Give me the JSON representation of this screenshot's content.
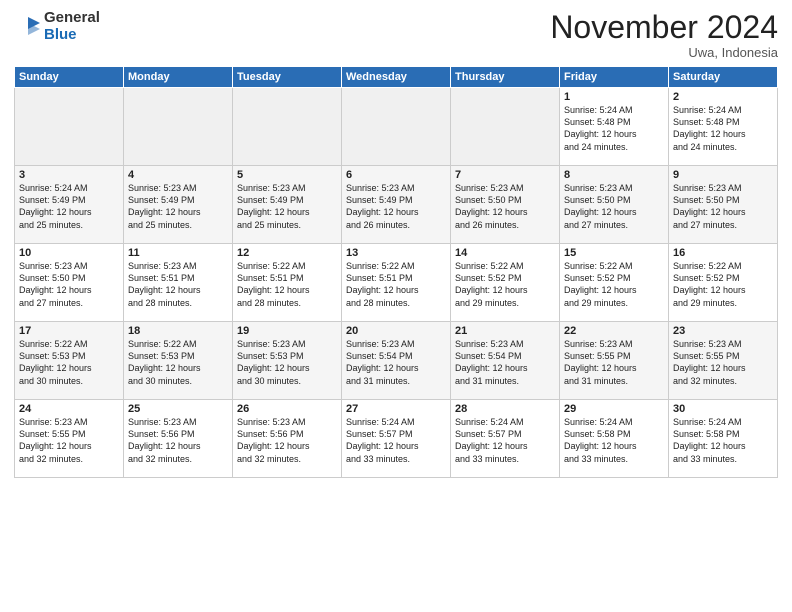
{
  "logo": {
    "general": "General",
    "blue": "Blue"
  },
  "title": "November 2024",
  "location": "Uwa, Indonesia",
  "headers": [
    "Sunday",
    "Monday",
    "Tuesday",
    "Wednesday",
    "Thursday",
    "Friday",
    "Saturday"
  ],
  "weeks": [
    [
      {
        "day": "",
        "info": ""
      },
      {
        "day": "",
        "info": ""
      },
      {
        "day": "",
        "info": ""
      },
      {
        "day": "",
        "info": ""
      },
      {
        "day": "",
        "info": ""
      },
      {
        "day": "1",
        "info": "Sunrise: 5:24 AM\nSunset: 5:48 PM\nDaylight: 12 hours\nand 24 minutes."
      },
      {
        "day": "2",
        "info": "Sunrise: 5:24 AM\nSunset: 5:48 PM\nDaylight: 12 hours\nand 24 minutes."
      }
    ],
    [
      {
        "day": "3",
        "info": "Sunrise: 5:24 AM\nSunset: 5:49 PM\nDaylight: 12 hours\nand 25 minutes."
      },
      {
        "day": "4",
        "info": "Sunrise: 5:23 AM\nSunset: 5:49 PM\nDaylight: 12 hours\nand 25 minutes."
      },
      {
        "day": "5",
        "info": "Sunrise: 5:23 AM\nSunset: 5:49 PM\nDaylight: 12 hours\nand 25 minutes."
      },
      {
        "day": "6",
        "info": "Sunrise: 5:23 AM\nSunset: 5:49 PM\nDaylight: 12 hours\nand 26 minutes."
      },
      {
        "day": "7",
        "info": "Sunrise: 5:23 AM\nSunset: 5:50 PM\nDaylight: 12 hours\nand 26 minutes."
      },
      {
        "day": "8",
        "info": "Sunrise: 5:23 AM\nSunset: 5:50 PM\nDaylight: 12 hours\nand 27 minutes."
      },
      {
        "day": "9",
        "info": "Sunrise: 5:23 AM\nSunset: 5:50 PM\nDaylight: 12 hours\nand 27 minutes."
      }
    ],
    [
      {
        "day": "10",
        "info": "Sunrise: 5:23 AM\nSunset: 5:50 PM\nDaylight: 12 hours\nand 27 minutes."
      },
      {
        "day": "11",
        "info": "Sunrise: 5:23 AM\nSunset: 5:51 PM\nDaylight: 12 hours\nand 28 minutes."
      },
      {
        "day": "12",
        "info": "Sunrise: 5:22 AM\nSunset: 5:51 PM\nDaylight: 12 hours\nand 28 minutes."
      },
      {
        "day": "13",
        "info": "Sunrise: 5:22 AM\nSunset: 5:51 PM\nDaylight: 12 hours\nand 28 minutes."
      },
      {
        "day": "14",
        "info": "Sunrise: 5:22 AM\nSunset: 5:52 PM\nDaylight: 12 hours\nand 29 minutes."
      },
      {
        "day": "15",
        "info": "Sunrise: 5:22 AM\nSunset: 5:52 PM\nDaylight: 12 hours\nand 29 minutes."
      },
      {
        "day": "16",
        "info": "Sunrise: 5:22 AM\nSunset: 5:52 PM\nDaylight: 12 hours\nand 29 minutes."
      }
    ],
    [
      {
        "day": "17",
        "info": "Sunrise: 5:22 AM\nSunset: 5:53 PM\nDaylight: 12 hours\nand 30 minutes."
      },
      {
        "day": "18",
        "info": "Sunrise: 5:22 AM\nSunset: 5:53 PM\nDaylight: 12 hours\nand 30 minutes."
      },
      {
        "day": "19",
        "info": "Sunrise: 5:23 AM\nSunset: 5:53 PM\nDaylight: 12 hours\nand 30 minutes."
      },
      {
        "day": "20",
        "info": "Sunrise: 5:23 AM\nSunset: 5:54 PM\nDaylight: 12 hours\nand 31 minutes."
      },
      {
        "day": "21",
        "info": "Sunrise: 5:23 AM\nSunset: 5:54 PM\nDaylight: 12 hours\nand 31 minutes."
      },
      {
        "day": "22",
        "info": "Sunrise: 5:23 AM\nSunset: 5:55 PM\nDaylight: 12 hours\nand 31 minutes."
      },
      {
        "day": "23",
        "info": "Sunrise: 5:23 AM\nSunset: 5:55 PM\nDaylight: 12 hours\nand 32 minutes."
      }
    ],
    [
      {
        "day": "24",
        "info": "Sunrise: 5:23 AM\nSunset: 5:55 PM\nDaylight: 12 hours\nand 32 minutes."
      },
      {
        "day": "25",
        "info": "Sunrise: 5:23 AM\nSunset: 5:56 PM\nDaylight: 12 hours\nand 32 minutes."
      },
      {
        "day": "26",
        "info": "Sunrise: 5:23 AM\nSunset: 5:56 PM\nDaylight: 12 hours\nand 32 minutes."
      },
      {
        "day": "27",
        "info": "Sunrise: 5:24 AM\nSunset: 5:57 PM\nDaylight: 12 hours\nand 33 minutes."
      },
      {
        "day": "28",
        "info": "Sunrise: 5:24 AM\nSunset: 5:57 PM\nDaylight: 12 hours\nand 33 minutes."
      },
      {
        "day": "29",
        "info": "Sunrise: 5:24 AM\nSunset: 5:58 PM\nDaylight: 12 hours\nand 33 minutes."
      },
      {
        "day": "30",
        "info": "Sunrise: 5:24 AM\nSunset: 5:58 PM\nDaylight: 12 hours\nand 33 minutes."
      }
    ]
  ]
}
